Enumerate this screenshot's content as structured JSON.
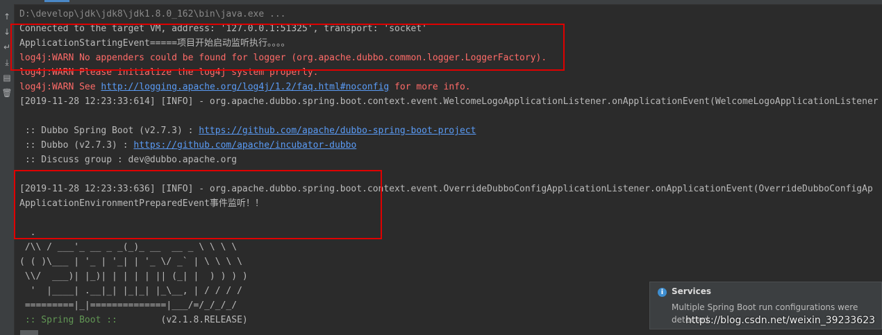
{
  "gutter": {
    "icons": [
      {
        "name": "up-arrow-icon",
        "glyph": "↑"
      },
      {
        "name": "down-arrow-icon",
        "glyph": "↓"
      },
      {
        "name": "soft-wrap-icon",
        "glyph": "↵"
      },
      {
        "name": "scroll-to-end-icon",
        "glyph": "⤓"
      },
      {
        "name": "print-icon",
        "glyph": "▤"
      },
      {
        "name": "trash-icon",
        "glyph": "🗑"
      }
    ]
  },
  "console": {
    "cmd": "D:\\develop\\jdk\\jdk8\\jdk1.8.0_162\\bin\\java.exe ...",
    "connected": "Connected to the target VM, address: '127.0.0.1:51325', transport: 'socket'",
    "starting": "ApplicationStartingEvent=====项目开始启动监听执行。。。。",
    "warn1": "log4j:WARN No appenders could be found for logger (org.apache.dubbo.common.logger.LoggerFactory).",
    "warn2": "log4j:WARN Please initialize the log4j system properly.",
    "warn3_pre": "log4j:WARN See ",
    "warn3_link": "http://logging.apache.org/log4j/1.2/faq.html#noconfig",
    "warn3_post": " for more info.",
    "info1": "[2019-11-28 12:23:33:614] [INFO] - org.apache.dubbo.spring.boot.context.event.WelcomeLogoApplicationListener.onApplicationEvent(WelcomeLogoApplicationListener",
    "dsb_pre": " :: Dubbo Spring Boot (v2.7.3) : ",
    "dsb_link": "https://github.com/apache/dubbo-spring-boot-project",
    "dubbo_pre": " :: Dubbo (v2.7.3) : ",
    "dubbo_link": "https://github.com/apache/incubator-dubbo",
    "discuss": " :: Discuss group : dev@dubbo.apache.org",
    "info2": "[2019-11-28 12:23:33:636] [INFO] - org.apache.dubbo.spring.boot.context.event.OverrideDubboConfigApplicationListener.onApplicationEvent(OverrideDubboConfigAp",
    "env_prepared": "ApplicationEnvironmentPreparedEvent事件监听！！",
    "banner": [
      "  .",
      " /\\\\ / ___'_ __ _ _(_)_ __  __ _ \\ \\ \\ \\",
      "( ( )\\___ | '_ | '_| | '_ \\/ _` | \\ \\ \\ \\",
      " \\\\/  ___)| |_)| | | | | || (_| |  ) ) ) )",
      "  '  |____| .__|_| |_|_| |_\\__, | / / / /",
      " =========|_|==============|___/=/_/_/_/"
    ],
    "spring_label": " :: Spring Boot :: ",
    "spring_version": "       (v2.1.8.RELEASE)"
  },
  "toast": {
    "title": "Services",
    "body": "Multiple Spring Boot run configurations were detected"
  },
  "watermark": "https://blog.csdn.net/weixin_39233623",
  "colors": {
    "background": "#2b2b2b",
    "text": "#bbbbbb",
    "error_red": "#ff6b68",
    "link_blue": "#5a9bf5",
    "spring_green": "#629755",
    "annotation_box": "#e00000"
  }
}
